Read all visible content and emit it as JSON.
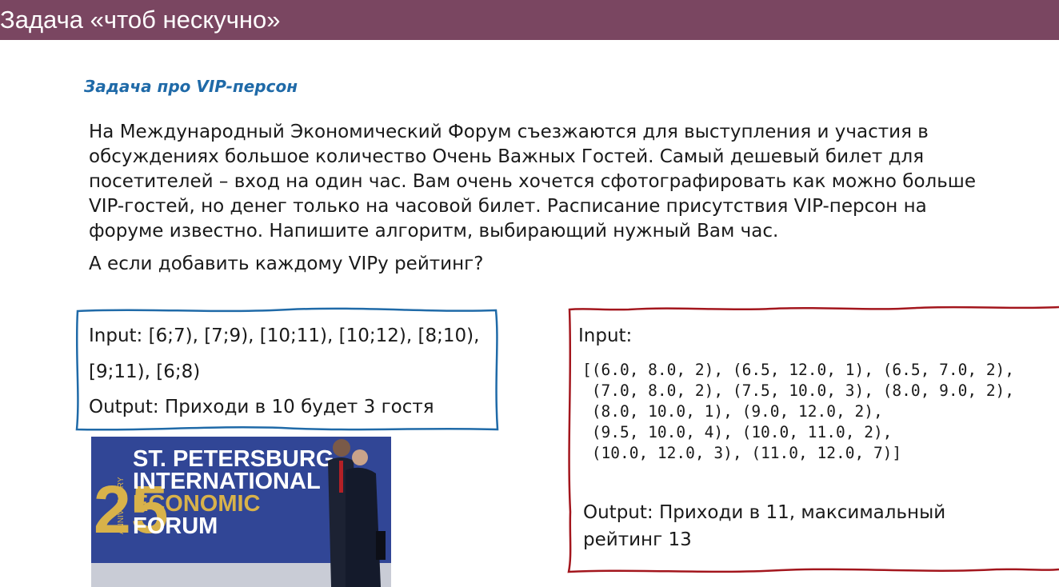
{
  "slide": {
    "title": "Задача «чтоб нескучно»",
    "subtitle": "Задача про VIP-персон",
    "paragraph_lines": [
      "На Международный Экономический Форум съезжаются для выступления и участия в",
      "обсуждениях большое количество Очень Важных Гостей. Самый дешевый билет для",
      "посетителей – вход на один час. Вам очень хочется сфотографировать как можно больше",
      "VIP-гостей, но денег только на часовой билет. Расписание присутствия VIP-персон на",
      "форуме известно. Напишите алгоритм, выбирающий нужный Вам час."
    ],
    "question": "А если добавить каждому VIPу рейтинг?"
  },
  "example1": {
    "input_line1": "Input: [6;7), [7;9), [10;11), [10;12), [8;10),",
    "input_line2": "[9;11), [6;8)",
    "output": "Output: Приходи в 10 будет 3 гостя",
    "border_color": "#1f6aa8"
  },
  "example2": {
    "input_label": "Input:",
    "data_lines": [
      "[(6.0, 8.0, 2), (6.5, 12.0, 1), (6.5, 7.0, 2),",
      " (7.0, 8.0, 2), (7.5, 10.0, 3), (8.0, 9.0, 2),",
      " (8.0, 10.0, 1), (9.0, 12.0, 2),",
      " (9.5, 10.0, 4), (10.0, 11.0, 2),",
      " (10.0, 12.0, 3), (11.0, 12.0, 7)]"
    ],
    "output_line1": "Output: Приходи в 11, максимальный",
    "output_line2": "рейтинг 13",
    "border_color": "#a3161d"
  },
  "photo": {
    "anniversary_number": "25",
    "anniversary_word": "ANNIVERSARY",
    "logo_lines": [
      "ST. PETERSBURG",
      "INTERNATIONAL",
      "ECONOMIC",
      "FORUM"
    ],
    "logo_colors": {
      "white": "#ffffff",
      "gold": "#d8b24a",
      "background": "#2d3f8c"
    }
  }
}
